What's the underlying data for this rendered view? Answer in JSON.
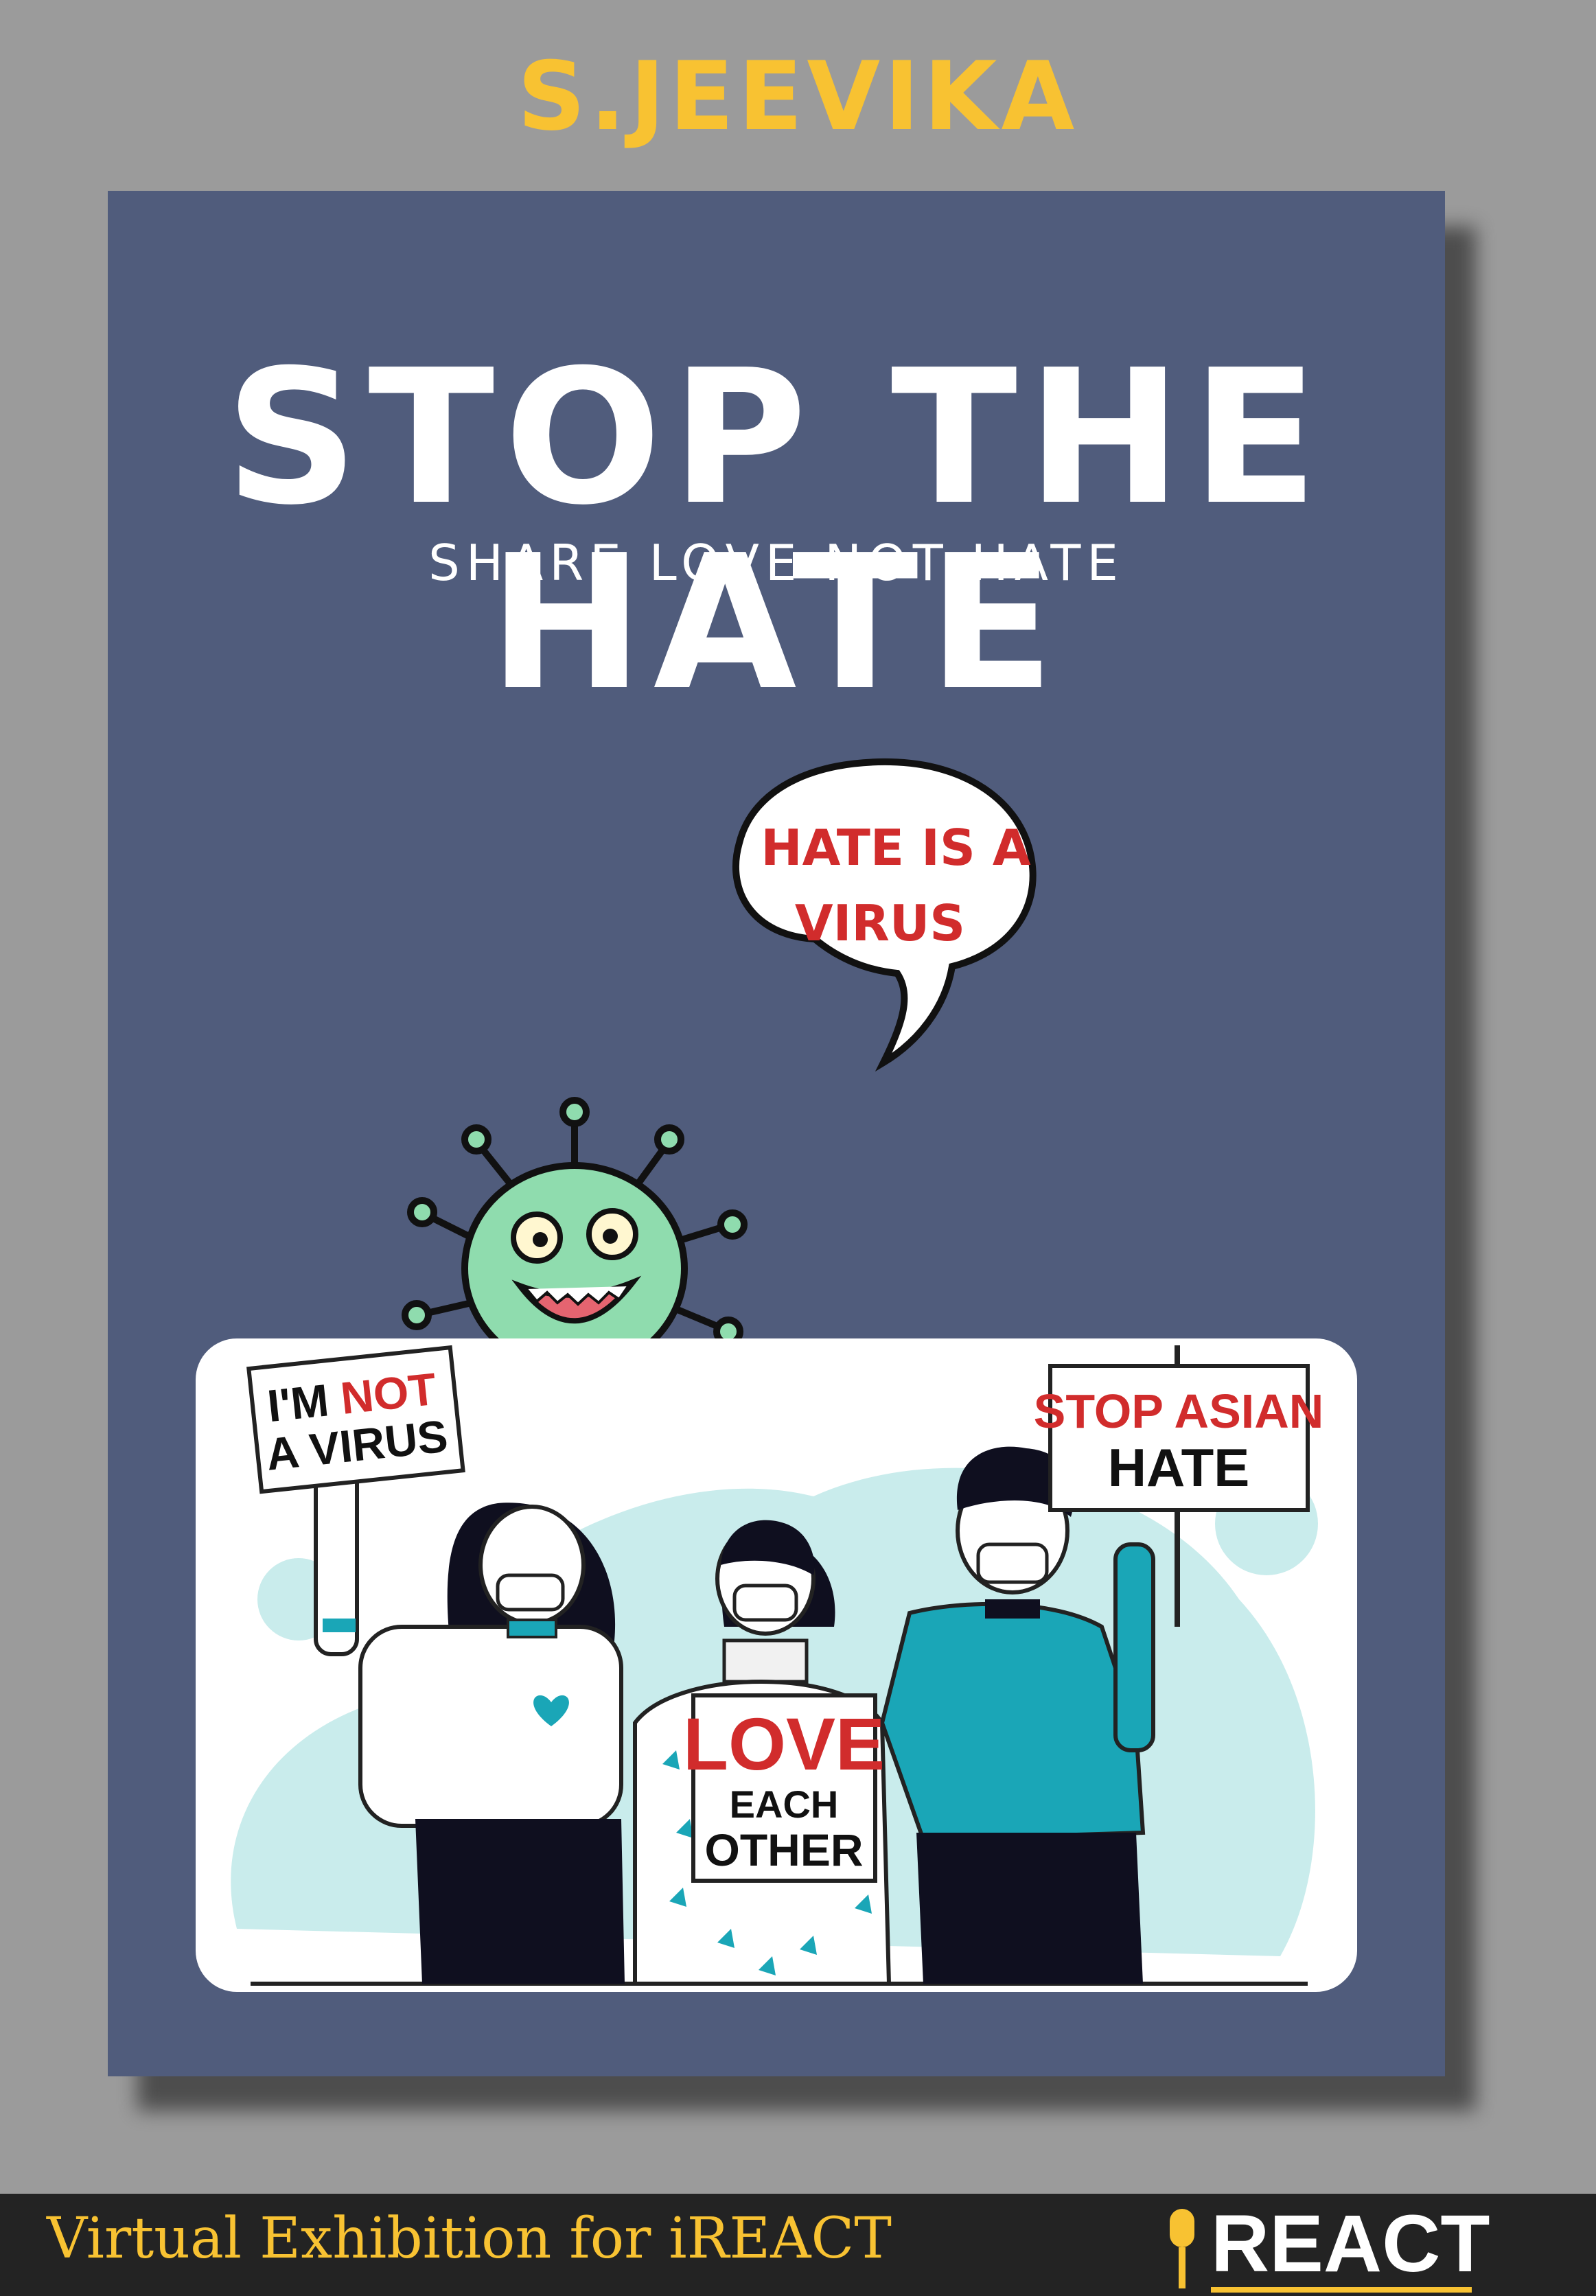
{
  "artist_name": "S.JEEVIKA",
  "poster": {
    "title": "STOP THE HATE",
    "subtitle": "SHARE LOVE NOT HATE",
    "speech_bubble": {
      "line1": "HATE IS A",
      "line2": "VIRUS"
    },
    "signs": {
      "left": {
        "line1_a": "I'M ",
        "line1_b": "NOT",
        "line2": "A VIRUS"
      },
      "right": {
        "line1": "STOP ASIAN",
        "line2": "HATE"
      },
      "center": {
        "line1": "LOVE",
        "line2": "EACH",
        "line3": "OTHER"
      }
    }
  },
  "footer": {
    "text": "Virtual Exhibition for iREACT",
    "logo_text": "REACT"
  },
  "colors": {
    "accent": "#f8c232",
    "poster_bg": "#505c7c",
    "sign_red": "#d12c2c",
    "virus_green": "#8fdcae",
    "teal": "#1aa6b7"
  }
}
